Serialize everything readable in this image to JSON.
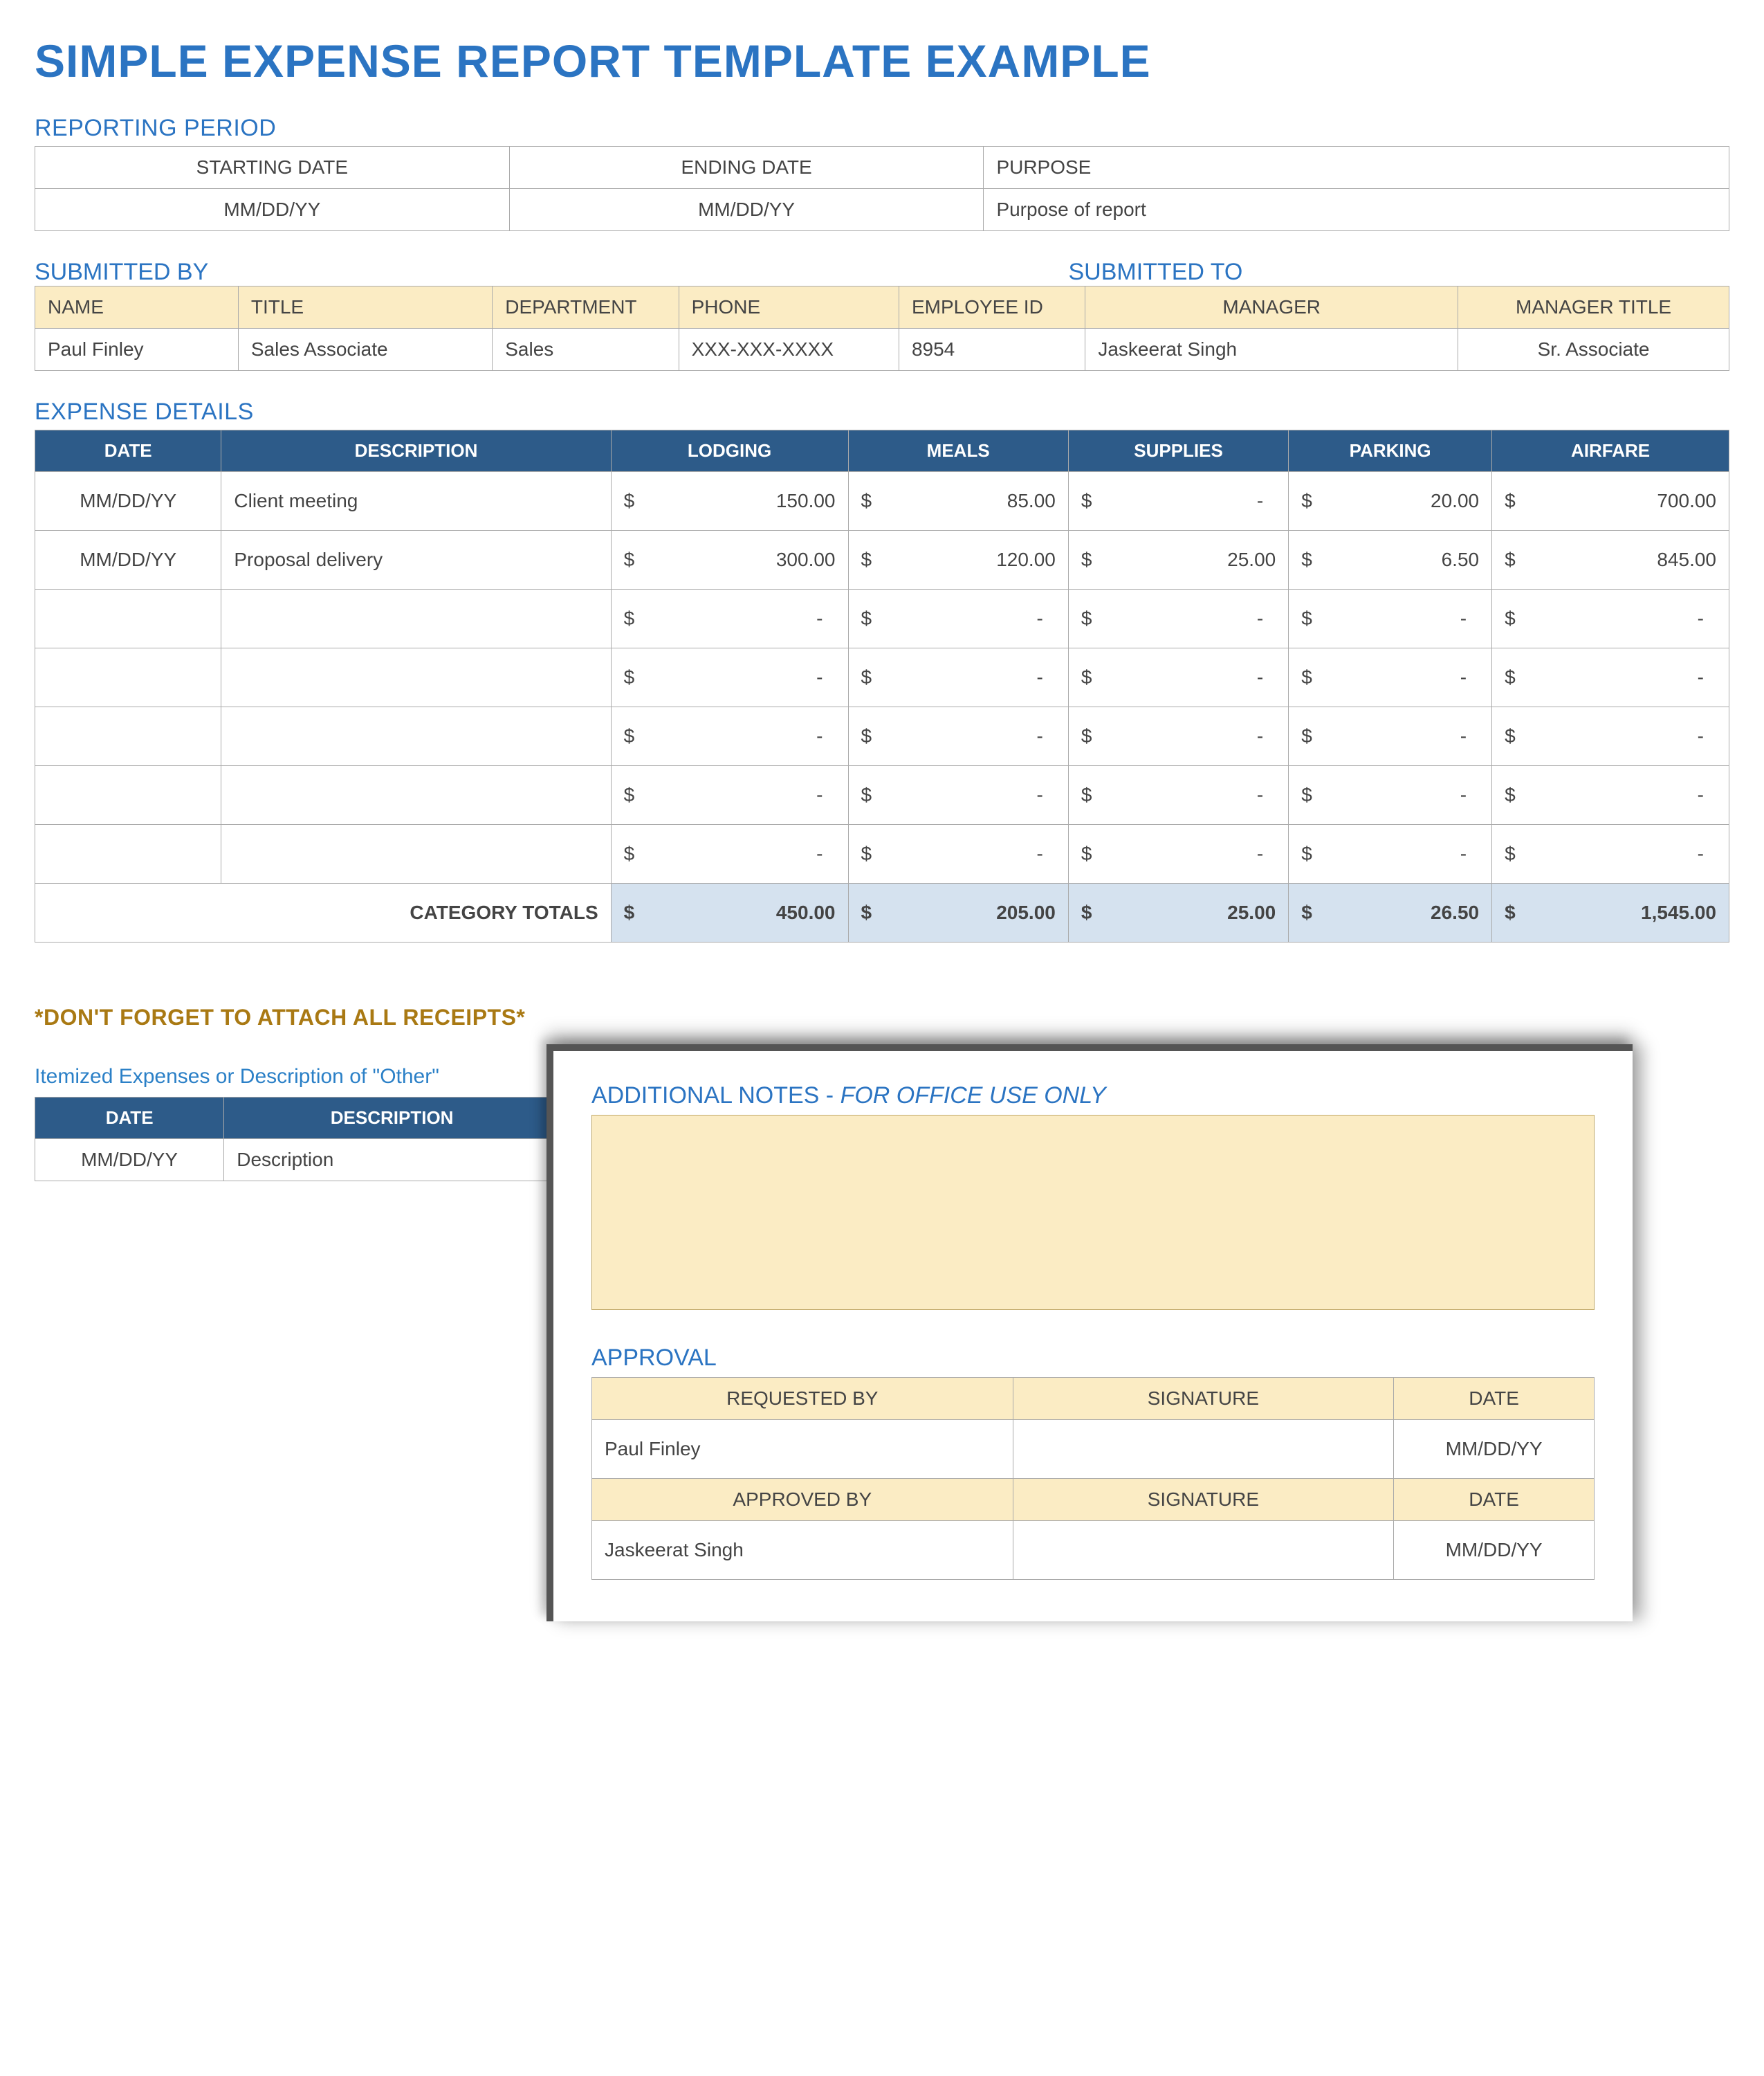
{
  "title": "SIMPLE EXPENSE REPORT TEMPLATE EXAMPLE",
  "reporting": {
    "heading": "REPORTING PERIOD",
    "headers": {
      "start": "STARTING DATE",
      "end": "ENDING DATE",
      "purpose": "PURPOSE"
    },
    "values": {
      "start": "MM/DD/YY",
      "end": "MM/DD/YY",
      "purpose": "Purpose of report"
    }
  },
  "submitted": {
    "by_heading": "SUBMITTED BY",
    "to_heading": "SUBMITTED TO",
    "headers": {
      "name": "NAME",
      "title": "TITLE",
      "dept": "DEPARTMENT",
      "phone": "PHONE",
      "empid": "EMPLOYEE ID",
      "manager": "MANAGER",
      "mgr_title": "MANAGER TITLE"
    },
    "values": {
      "name": "Paul Finley",
      "title": "Sales Associate",
      "dept": "Sales",
      "phone": "XXX-XXX-XXXX",
      "empid": "8954",
      "manager": "Jaskeerat Singh",
      "mgr_title": "Sr. Associate"
    }
  },
  "details": {
    "heading": "EXPENSE DETAILS",
    "headers": {
      "date": "DATE",
      "desc": "DESCRIPTION",
      "lodging": "LODGING",
      "meals": "MEALS",
      "supplies": "SUPPLIES",
      "parking": "PARKING",
      "airfare": "AIRFARE"
    },
    "rows": [
      {
        "date": "MM/DD/YY",
        "desc": "Client meeting",
        "lodging": "150.00",
        "meals": "85.00",
        "supplies": "-",
        "parking": "20.00",
        "airfare": "700.00"
      },
      {
        "date": "MM/DD/YY",
        "desc": "Proposal delivery",
        "lodging": "300.00",
        "meals": "120.00",
        "supplies": "25.00",
        "parking": "6.50",
        "airfare": "845.00"
      },
      {
        "date": "",
        "desc": "",
        "lodging": "-",
        "meals": "-",
        "supplies": "-",
        "parking": "-",
        "airfare": "-"
      },
      {
        "date": "",
        "desc": "",
        "lodging": "-",
        "meals": "-",
        "supplies": "-",
        "parking": "-",
        "airfare": "-"
      },
      {
        "date": "",
        "desc": "",
        "lodging": "-",
        "meals": "-",
        "supplies": "-",
        "parking": "-",
        "airfare": "-"
      },
      {
        "date": "",
        "desc": "",
        "lodging": "-",
        "meals": "-",
        "supplies": "-",
        "parking": "-",
        "airfare": "-"
      },
      {
        "date": "",
        "desc": "",
        "lodging": "-",
        "meals": "-",
        "supplies": "-",
        "parking": "-",
        "airfare": "-"
      }
    ],
    "totals_label": "CATEGORY TOTALS",
    "totals": {
      "lodging": "450.00",
      "meals": "205.00",
      "supplies": "25.00",
      "parking": "26.50",
      "airfare": "1,545.00"
    }
  },
  "receipts_note": "*DON'T FORGET TO ATTACH ALL RECEIPTS*",
  "itemized": {
    "label": "Itemized Expenses or Description of \"Other\"",
    "headers": {
      "date": "DATE",
      "desc": "DESCRIPTION"
    },
    "rows": [
      {
        "date": "MM/DD/YY",
        "desc": "Description"
      }
    ]
  },
  "overlay": {
    "notes_title": "ADDITIONAL NOTES - ",
    "notes_title_em": "FOR OFFICE USE ONLY",
    "approval_heading": "APPROVAL",
    "headers": {
      "req": "REQUESTED BY",
      "sig": "SIGNATURE",
      "date": "DATE",
      "appr": "APPROVED BY"
    },
    "requested": {
      "name": "Paul Finley",
      "date": "MM/DD/YY"
    },
    "approved": {
      "name": "Jaskeerat Singh",
      "date": "MM/DD/YY"
    }
  }
}
